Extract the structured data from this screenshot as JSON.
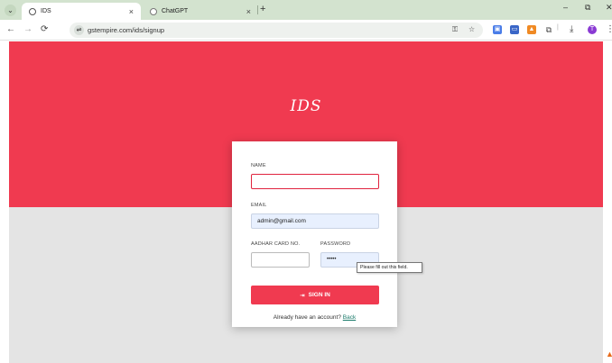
{
  "browser": {
    "tabs": [
      {
        "title": "IDS",
        "active": true
      },
      {
        "title": "ChatGPT",
        "active": false
      }
    ],
    "new_tab": "+",
    "url": "gstempire.com/ids/signup",
    "window": {
      "minimize": "–",
      "restore": "⧉",
      "close": "✕"
    }
  },
  "page": {
    "brand": "IDS",
    "colors": {
      "accent": "#f03a50",
      "link": "#1a7a6a"
    },
    "form": {
      "name_label": "NAME",
      "name_value": "",
      "email_label": "EMAIL",
      "email_value": "admin@gmail.com",
      "aadhar_label": "AADHAR CARD NO.",
      "aadhar_value": "",
      "password_label": "PASSWORD",
      "password_value": "•••••",
      "submit_label": "SIGN IN",
      "footer_text": "Already have an account?",
      "footer_link": "Back"
    },
    "tooltip": "Please fill out this field."
  }
}
